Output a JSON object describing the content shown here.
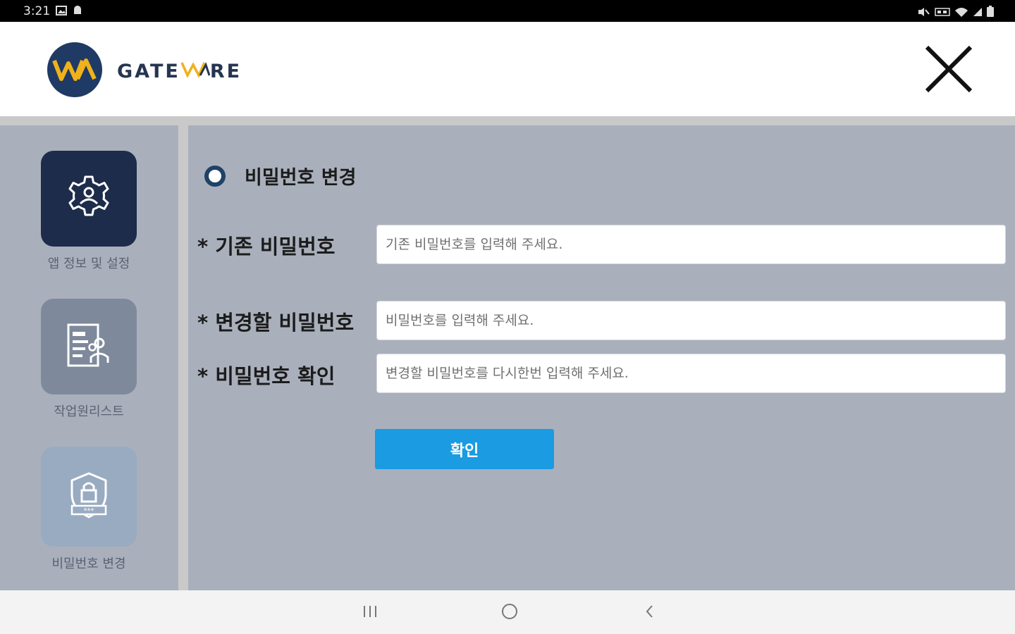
{
  "status": {
    "time": "3:21"
  },
  "header": {
    "brand_gate": "GATE",
    "brand_re": "RE"
  },
  "sidebar": {
    "items": [
      {
        "label": "앱 정보 및 설정",
        "icon": "settings-user-icon",
        "tile_color": "#1e2c4b"
      },
      {
        "label": "작업원리스트",
        "icon": "worker-list-icon",
        "tile_color": "#7e899b"
      },
      {
        "label": "비밀번호 변경",
        "icon": "password-lock-icon",
        "tile_color": "#98abc1"
      }
    ]
  },
  "main": {
    "section_title": "비밀번호 변경",
    "fields": [
      {
        "label": "* 기존 비밀번호",
        "placeholder": "기존 비밀번호를 입력해 주세요."
      },
      {
        "label": "* 변경할 비밀번호",
        "placeholder": "비밀번호를 입력해 주세요."
      },
      {
        "label": "* 비밀번호 확인",
        "placeholder": "변경할 비밀번호를 다시한번 입력해 주세요."
      }
    ],
    "confirm_label": "확인"
  },
  "colors": {
    "accent": "#1a9be2",
    "brand_navy": "#1f3a64",
    "brand_gold": "#f0b11b",
    "panel": "#a9b0bc"
  }
}
